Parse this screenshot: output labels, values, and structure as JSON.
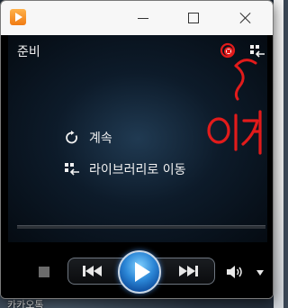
{
  "desktop": {
    "label": "카카오톡"
  },
  "window": {
    "title_buttons": {
      "minimize": "minimize",
      "maximize": "maximize",
      "close": "close"
    }
  },
  "player": {
    "status": "준비",
    "menu": [
      {
        "label": "계속",
        "icon": "repeat-icon"
      },
      {
        "label": "라이브러리로 이동",
        "icon": "switch-to-library-icon"
      }
    ],
    "annotation_text": "이거"
  },
  "colors": {
    "accent": "#2b86d6",
    "annotation": "#e21b1b",
    "stage_background": "#0d1b2a"
  }
}
